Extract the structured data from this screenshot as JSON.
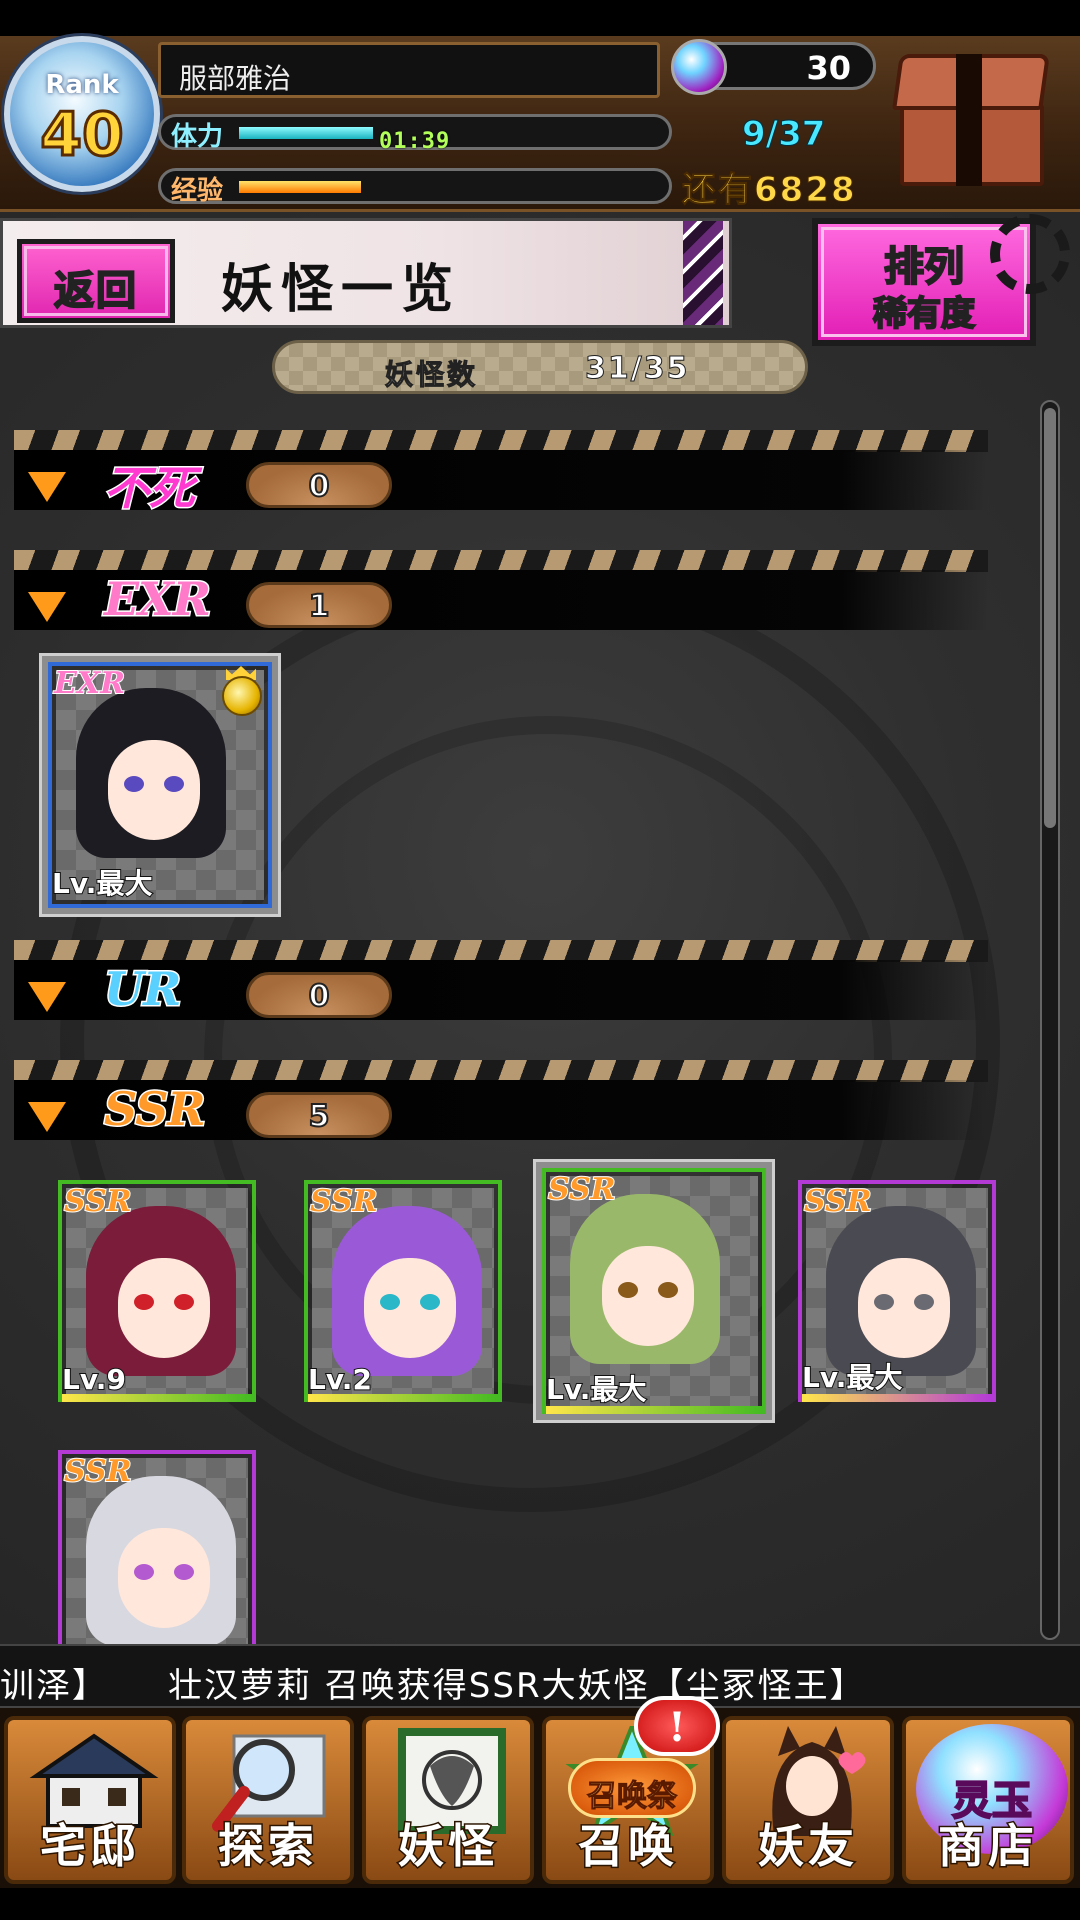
{
  "status": {
    "rank_label": "Rank",
    "rank": "40",
    "player_name": "服部雅治",
    "stamina_label": "体力",
    "stamina_timer": "01:39",
    "stamina_fill": 0.32,
    "stamina_count": "9/37",
    "exp_label": "经验",
    "exp_fill": 0.29,
    "exp_remaining": "还有6828",
    "orb_count": "30"
  },
  "header": {
    "back_label": "返回",
    "title": "妖怪一览",
    "sort_line1": "排列",
    "sort_line2": "稀有度",
    "count_label": "妖怪数",
    "count_value": "31/35"
  },
  "rarities": [
    {
      "name": "不死",
      "count": "0",
      "color": "#ff3ad0"
    },
    {
      "name": "EXR",
      "count": "1",
      "color": "#ff7ac8"
    },
    {
      "name": "UR",
      "count": "0",
      "color": "#5ad0ff"
    },
    {
      "name": "SSR",
      "count": "5",
      "color": "#ff9a2a"
    }
  ],
  "cards": [
    {
      "badge": "EXR",
      "level": "Lv.最大",
      "hair": "#1c1c22",
      "eyes": "#5a4ac0"
    },
    {
      "badge": "SSR",
      "level": "Lv.9",
      "hair": "#7a1c3a",
      "eyes": "#d0202a"
    },
    {
      "badge": "SSR",
      "level": "Lv.2",
      "hair": "#9a5ad8",
      "eyes": "#2ab8c8"
    },
    {
      "badge": "SSR",
      "level": "Lv.最大",
      "hair": "#9ab86a",
      "eyes": "#8a5a1a"
    },
    {
      "badge": "SSR",
      "level": "Lv.最大",
      "hair": "#4a4a52",
      "eyes": "#6a6a72"
    },
    {
      "badge": "SSR",
      "level": "",
      "hair": "#d8d8e0",
      "eyes": "#b45ad0"
    }
  ],
  "ticker": {
    "left": "训泽】",
    "main": "壮汉萝莉 召唤获得SSR大妖怪【尘冢怪王】"
  },
  "nav": {
    "home": "宅邸",
    "explore": "探索",
    "yokai": "妖怪",
    "summon_badge": "召唤祭",
    "summon": "召唤",
    "friends": "妖友",
    "shop_orb": "灵玉",
    "shop": "商店",
    "alert": "!"
  }
}
